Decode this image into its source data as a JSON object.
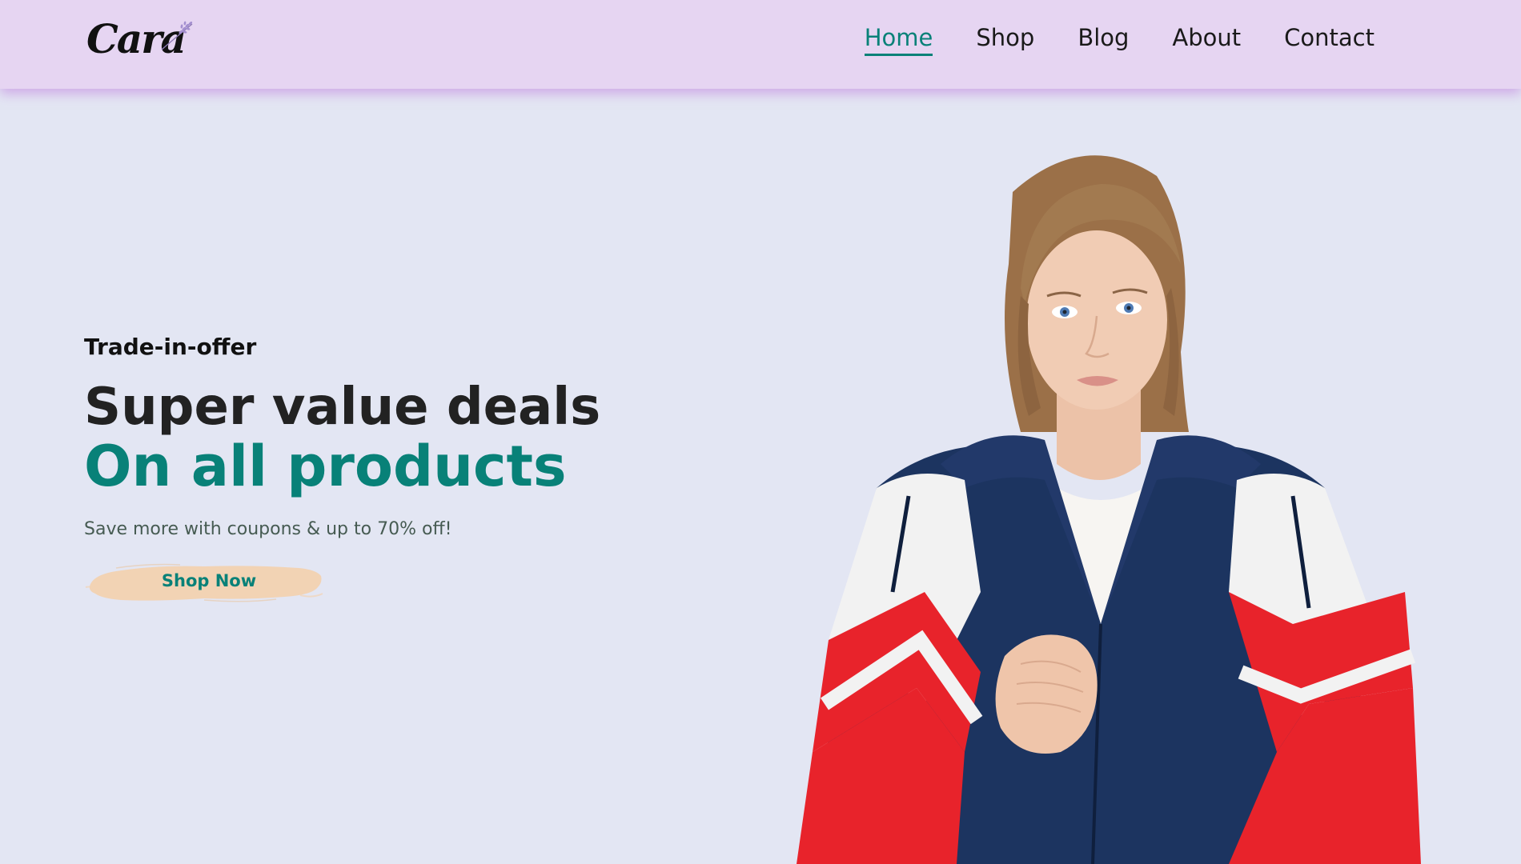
{
  "header": {
    "logo_text": "Cara",
    "logo_icon": "lavender-sprig-icon",
    "nav": [
      {
        "label": "Home",
        "active": true
      },
      {
        "label": "Shop",
        "active": false
      },
      {
        "label": "Blog",
        "active": false
      },
      {
        "label": "About",
        "active": false
      },
      {
        "label": "Contact",
        "active": false
      }
    ]
  },
  "hero": {
    "eyebrow": "Trade-in-offer",
    "headline": "Super value deals",
    "subheadline": "On all products",
    "tagline": "Save more with coupons & up to 70% off!",
    "button_label": "Shop Now",
    "image": "model-in-tracksuit-jacket"
  },
  "colors": {
    "accent": "#088178",
    "header_bg": "#e6d5f2",
    "page_bg": "#e3e6f3",
    "button_brush": "#f2d3b4"
  }
}
